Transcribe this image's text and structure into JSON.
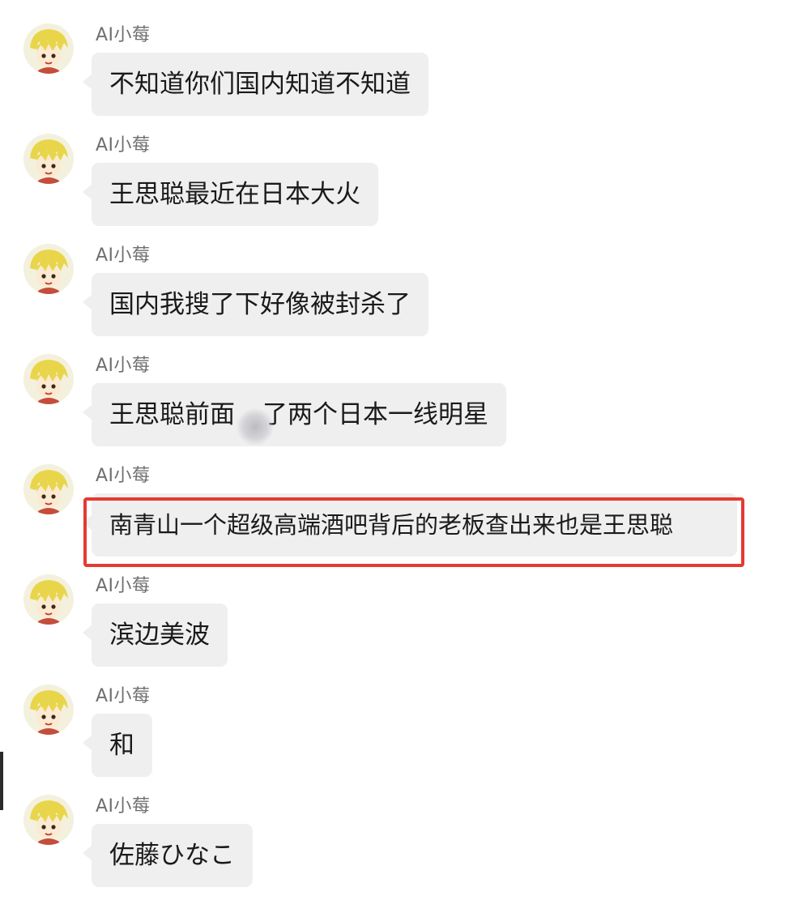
{
  "chat": {
    "messages": [
      {
        "sender": "AI小莓",
        "text": "不知道你们国内知道不知道"
      },
      {
        "sender": "AI小莓",
        "text": "王思聪最近在日本大火"
      },
      {
        "sender": "AI小莓",
        "text": "国内我搜了下好像被封杀了"
      },
      {
        "sender": "AI小莓",
        "text": "王思聪前面",
        "text_after_redaction": "了两个日本一线明星",
        "redacted": true
      },
      {
        "sender": "AI小莓",
        "text": "南青山一个超级高端酒吧背后的老板查出来也是王思聪",
        "highlighted": true
      },
      {
        "sender": "AI小莓",
        "text": "滨边美波"
      },
      {
        "sender": "AI小莓",
        "text": "和"
      },
      {
        "sender": "AI小莓",
        "text": "佐藤ひなこ"
      }
    ]
  },
  "colors": {
    "bubble_background": "#efeff0",
    "highlight_border": "#e53a32",
    "sender_text": "#6f6f6f",
    "message_text": "#1a1a1a"
  },
  "icons": {
    "avatar": "anime-avatar-icon"
  }
}
